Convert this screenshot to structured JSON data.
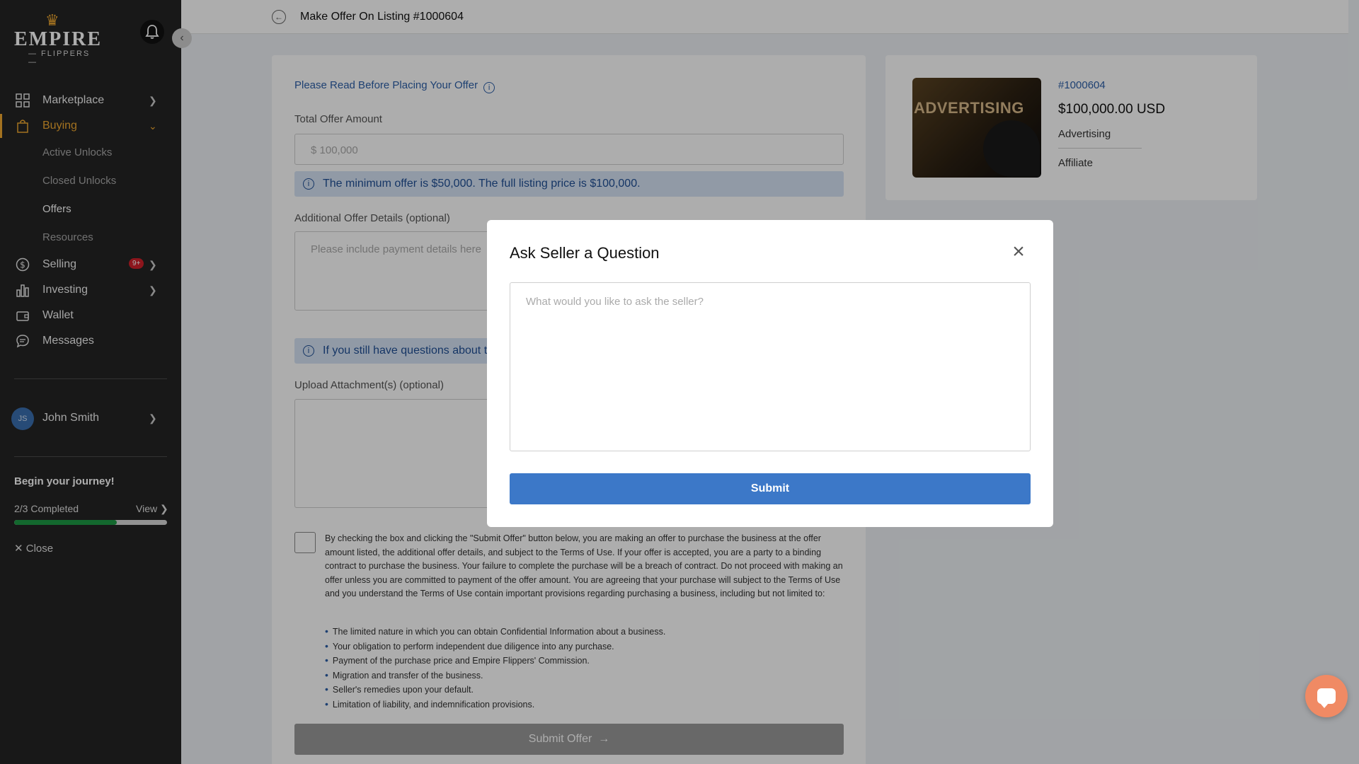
{
  "brand": {
    "name": "EMPIRE",
    "sub": "— FLIPPERS —",
    "accent": "#f0a830"
  },
  "header": {
    "title": "Make Offer On Listing #1000604"
  },
  "sidebar": {
    "items": [
      {
        "label": "Marketplace"
      },
      {
        "label": "Buying"
      },
      {
        "label": "Selling",
        "badge": "9+"
      },
      {
        "label": "Investing"
      },
      {
        "label": "Wallet"
      },
      {
        "label": "Messages"
      }
    ],
    "buying_sub": [
      "Active Unlocks",
      "Closed Unlocks",
      "Offers",
      "Resources"
    ],
    "user": {
      "initials": "JS",
      "name": "John Smith"
    },
    "journey": {
      "title": "Begin your journey!",
      "progress": "2/3 Completed",
      "progress_fraction": 0.67,
      "view": "View",
      "close": "Close"
    }
  },
  "form": {
    "read_link": "Please Read Before Placing Your Offer",
    "offer_label": "Total Offer Amount",
    "offer_value": "$ 100,000",
    "min_notice": "The minimum offer is $50,000. The full listing price is $100,000.",
    "details_label": "Additional Offer Details (optional)",
    "details_placeholder": "Please include payment details here",
    "questions_notice": "If you still have questions about th",
    "upload_label": "Upload Attachment(s) (optional)",
    "terms": "By checking the box and clicking the \"Submit Offer\" button below, you are making an offer to purchase the business at the offer amount listed, the additional offer details, and subject to the Terms of Use. If your offer is accepted, you are a party to a binding contract to purchase the business. Your failure to complete the purchase will be a breach of contract. Do not proceed with making an offer unless you are committed to payment of the offer amount. You are agreeing that your purchase will subject to the Terms of Use and you understand the Terms of Use contain important provisions regarding purchasing a business, including but not limited to:",
    "bullets": [
      "The limited nature in which you can obtain Confidential Information about a business.",
      "Your obligation to perform independent due diligence into any purchase.",
      "Payment of the purchase price and Empire Flippers' Commission.",
      "Migration and transfer of the business.",
      "Seller's remedies upon your default.",
      "Limitation of liability, and indemnification provisions."
    ],
    "submit_label": "Submit Offer"
  },
  "listing": {
    "id": "#1000604",
    "price": "$100,000.00 USD",
    "category": "Advertising",
    "type": "Affiliate",
    "image_text": "ADVERTISING"
  },
  "modal": {
    "title": "Ask Seller a Question",
    "placeholder": "What would you like to ask the seller?",
    "submit": "Submit",
    "button_color": "#3c78c8"
  }
}
